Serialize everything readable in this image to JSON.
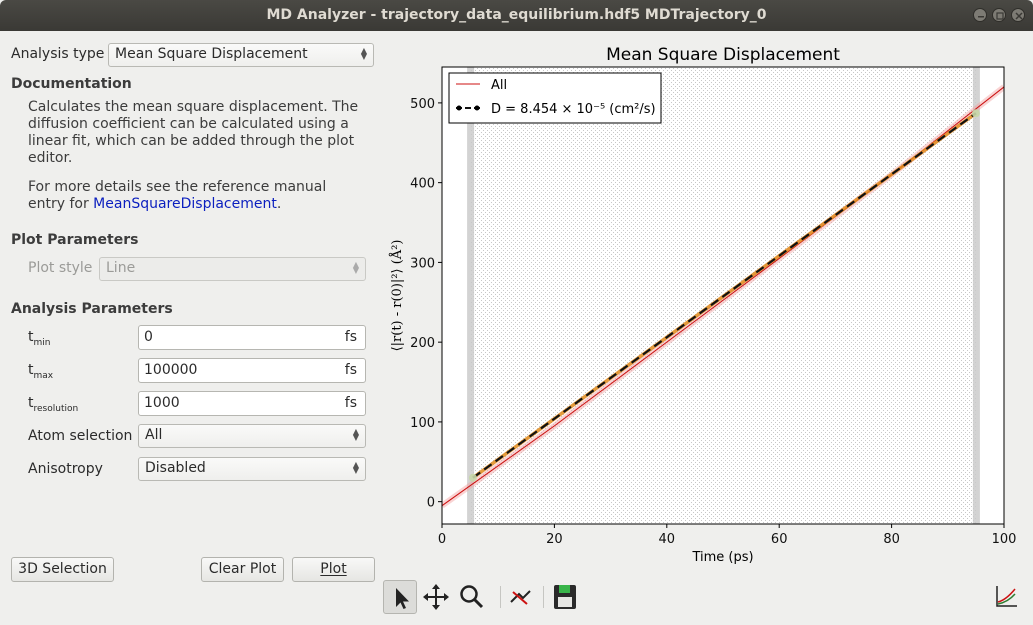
{
  "window": {
    "title": "MD Analyzer - trajectory_data_equilibrium.hdf5 MDTrajectory_0"
  },
  "analysis_type": {
    "label": "Analysis type",
    "value": "Mean Square Displacement"
  },
  "documentation": {
    "heading": "Documentation",
    "para1": "Calculates the mean square displacement. The diffusion coefficient can be calculated using a linear fit, which can be added through the plot editor.",
    "para2_prefix": "For more details see the reference manual entry for ",
    "link": "MeanSquareDisplacement",
    "para2_suffix": "."
  },
  "plot_params": {
    "heading": "Plot Parameters",
    "style_label": "Plot style",
    "style_value": "Line"
  },
  "analysis_params": {
    "heading": "Analysis Parameters",
    "tmin": {
      "label": "t",
      "sub": "min",
      "value": "0",
      "unit": "fs"
    },
    "tmax": {
      "label": "t",
      "sub": "max",
      "value": "100000",
      "unit": "fs"
    },
    "tres": {
      "label": "t",
      "sub": "resolution",
      "value": "1000",
      "unit": "fs"
    },
    "atom_selection": {
      "label": "Atom selection",
      "value": "All"
    },
    "anisotropy": {
      "label": "Anisotropy",
      "value": "Disabled"
    }
  },
  "buttons": {
    "selection3d": "3D Selection",
    "clear_plot": "Clear Plot",
    "plot": "Plot"
  },
  "toolbar_icons": [
    "pointer-icon",
    "pan-icon",
    "zoom-icon",
    "fit-icon",
    "save-icon",
    "plot-settings-icon"
  ],
  "chart_data": {
    "type": "line",
    "title": "Mean Square Displacement",
    "xlabel": "Time",
    "xunit": "ps",
    "ylabel": "⟨|r(t) - r(0)|²⟩",
    "yunit": "Å²",
    "xlim": [
      0,
      100
    ],
    "ylim": [
      -28,
      545
    ],
    "xticks": [
      0,
      20,
      40,
      60,
      80,
      100
    ],
    "yticks": [
      0,
      100,
      200,
      300,
      400,
      500
    ],
    "series": [
      {
        "name": "All",
        "color": "#cc1111",
        "x": [
          0,
          20,
          40,
          60,
          80,
          100
        ],
        "y": [
          -5,
          95,
          200,
          305,
          410,
          520
        ]
      },
      {
        "name": "D = 8.454 × 10⁻⁵ (cm²/s)",
        "color": "#000000",
        "style": "dashed",
        "x": [
          5.5,
          95
        ],
        "y": [
          30,
          487
        ]
      }
    ],
    "fit_range": [
      5,
      95
    ],
    "legend_position": "top-left",
    "legend": [
      "All",
      "D = 8.454 × 10⁻⁵ (cm²/s)"
    ]
  }
}
